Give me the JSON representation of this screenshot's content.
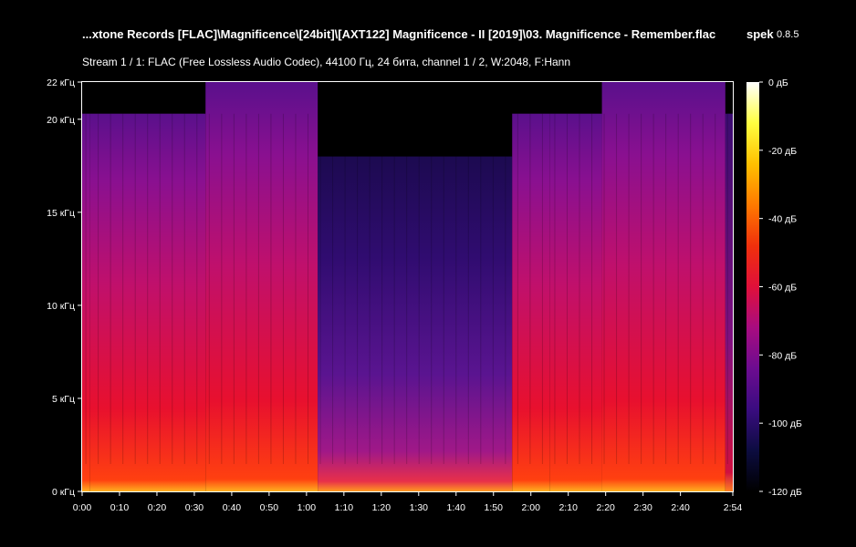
{
  "header": {
    "title": "...xtone Records [FLAC]\\Magnificence\\[24bit]\\[AXT122] Magnificence - II [2019]\\03. Magnificence - Remember.flac",
    "app_name": "spek",
    "app_version": "0.8.5",
    "subtitle": "Stream 1 / 1: FLAC (Free Lossless Audio Codec), 44100 Гц, 24 бита, channel 1 / 2, W:2048, F:Hann"
  },
  "chart_data": {
    "type": "heatmap",
    "x_label": "",
    "y_label": "",
    "xlim_seconds": [
      0,
      174
    ],
    "ylim_khz": [
      0,
      22
    ],
    "clim_db": [
      -120,
      0
    ],
    "x_ticks": [
      {
        "t": 0,
        "label": "0:00"
      },
      {
        "t": 10,
        "label": "0:10"
      },
      {
        "t": 20,
        "label": "0:20"
      },
      {
        "t": 30,
        "label": "0:30"
      },
      {
        "t": 40,
        "label": "0:40"
      },
      {
        "t": 50,
        "label": "0:50"
      },
      {
        "t": 60,
        "label": "1:00"
      },
      {
        "t": 70,
        "label": "1:10"
      },
      {
        "t": 80,
        "label": "1:20"
      },
      {
        "t": 90,
        "label": "1:30"
      },
      {
        "t": 100,
        "label": "1:40"
      },
      {
        "t": 110,
        "label": "1:50"
      },
      {
        "t": 120,
        "label": "2:00"
      },
      {
        "t": 130,
        "label": "2:10"
      },
      {
        "t": 140,
        "label": "2:20"
      },
      {
        "t": 150,
        "label": "2:30"
      },
      {
        "t": 160,
        "label": "2:40"
      },
      {
        "t": 174,
        "label": "2:54"
      }
    ],
    "y_ticks": [
      {
        "f": 0,
        "label": "0 кГц"
      },
      {
        "f": 5,
        "label": "5 кГц"
      },
      {
        "f": 10,
        "label": "10 кГц"
      },
      {
        "f": 15,
        "label": "15 кГц"
      },
      {
        "f": 20,
        "label": "20 кГц"
      },
      {
        "f": 22,
        "label": "22 кГц"
      }
    ],
    "colorbar_ticks": [
      {
        "db": 0,
        "label": "0 дБ"
      },
      {
        "db": -20,
        "label": "-20 дБ"
      },
      {
        "db": -40,
        "label": "-40 дБ"
      },
      {
        "db": -60,
        "label": "-60 дБ"
      },
      {
        "db": -80,
        "label": "-80 дБ"
      },
      {
        "db": -100,
        "label": "-100 дБ"
      },
      {
        "db": -120,
        "label": "-120 дБ"
      }
    ],
    "colormap": [
      "#000000",
      "#0c0c40",
      "#3a0c80",
      "#6c0c90",
      "#a80c80",
      "#e0103a",
      "#f0300c",
      "#ff7a00",
      "#ffc000",
      "#ffff40",
      "#ffffff"
    ],
    "sections": [
      {
        "start_s": 0,
        "end_s": 2,
        "cutoff_khz": 20.3,
        "level": "loud"
      },
      {
        "start_s": 2,
        "end_s": 33,
        "cutoff_khz": 20.3,
        "level": "loud"
      },
      {
        "start_s": 33,
        "end_s": 63,
        "cutoff_khz": 22,
        "level": "loud"
      },
      {
        "start_s": 63,
        "end_s": 115,
        "cutoff_khz": 18,
        "level": "quiet"
      },
      {
        "start_s": 115,
        "end_s": 125,
        "cutoff_khz": 20.3,
        "level": "loud"
      },
      {
        "start_s": 125,
        "end_s": 139,
        "cutoff_khz": 20.3,
        "level": "loud"
      },
      {
        "start_s": 139,
        "end_s": 172,
        "cutoff_khz": 22,
        "level": "loud"
      },
      {
        "start_s": 172,
        "end_s": 174,
        "cutoff_khz": 20.3,
        "level": "fade"
      }
    ]
  }
}
